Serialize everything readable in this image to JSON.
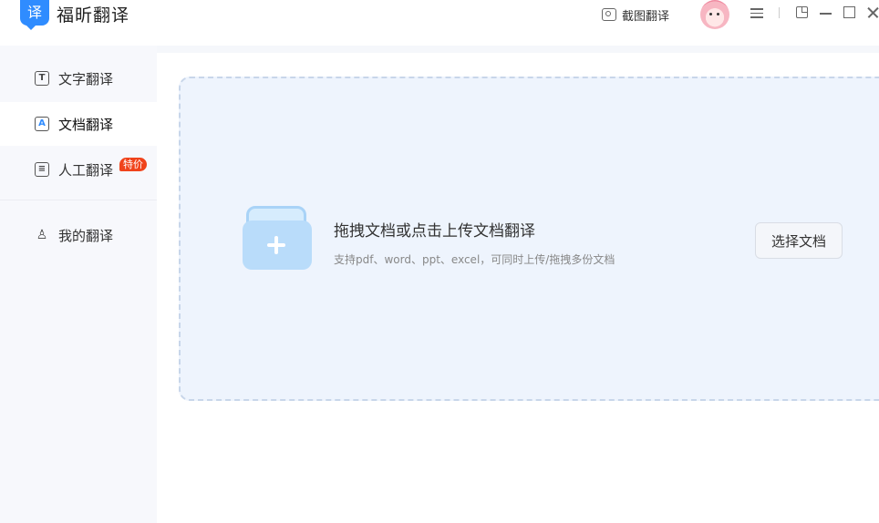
{
  "app": {
    "logo_char": "译",
    "title": "福昕翻译"
  },
  "toolbar": {
    "screenshot_label": "截图翻译"
  },
  "sidebar": {
    "items": [
      {
        "label": "文字翻译",
        "icon": "text-box-icon",
        "icon_glyph": "T"
      },
      {
        "label": "文档翻译",
        "icon": "document-a-icon",
        "icon_glyph": "A",
        "active": true
      },
      {
        "label": "人工翻译",
        "icon": "human-translate-icon",
        "icon_glyph": "≡",
        "badge": "特价"
      },
      {
        "label": "我的翻译",
        "icon": "user-list-icon",
        "icon_glyph": "♙"
      }
    ]
  },
  "main": {
    "dropzone": {
      "title": "拖拽文档或点击上传文档翻译",
      "subtitle": "支持pdf、word、ppt、excel，可同时上传/拖拽多份文档",
      "button_label": "选择文档"
    }
  },
  "colors": {
    "accent": "#2f8cff",
    "badge": "#f0431b",
    "dropzone_bg": "#eef4fd"
  }
}
